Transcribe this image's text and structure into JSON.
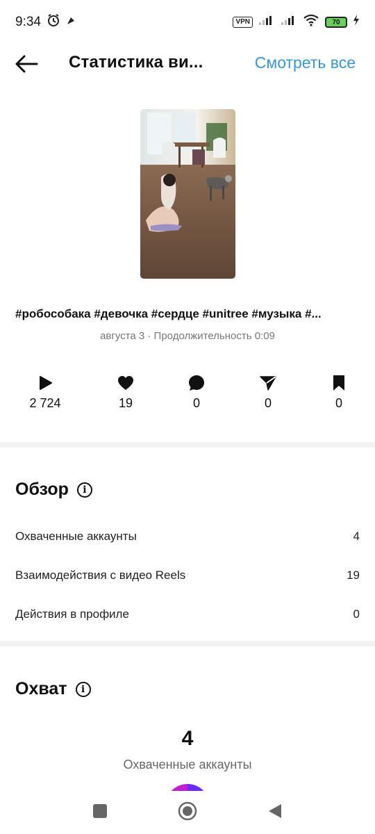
{
  "status_bar": {
    "time": "9:34",
    "vpn": "VPN",
    "battery": "70",
    "icons": [
      "alarm-icon",
      "notification-icon",
      "signal-icon",
      "wifi-icon",
      "charging-icon"
    ]
  },
  "header": {
    "title": "Статистика ви...",
    "see_all": "Смотреть все"
  },
  "post": {
    "caption": "#робособака #девочка #сердце #unitree #музыка #...",
    "meta": "августа 3 · Продолжительность 0:09"
  },
  "metrics": [
    {
      "icon": "play-icon",
      "value": "2 724"
    },
    {
      "icon": "heart-icon",
      "value": "19"
    },
    {
      "icon": "comment-icon",
      "value": "0"
    },
    {
      "icon": "share-icon",
      "value": "0"
    },
    {
      "icon": "bookmark-icon",
      "value": "0"
    }
  ],
  "overview": {
    "title": "Обзор",
    "rows": [
      {
        "label": "Охваченные аккаунты",
        "value": "4"
      },
      {
        "label": "Взаимодействия с видео Reels",
        "value": "19"
      },
      {
        "label": "Действия в профиле",
        "value": "0"
      }
    ]
  },
  "reach": {
    "title": "Охват",
    "count": "4",
    "label": "Охваченные аккаунты"
  },
  "colors": {
    "accent": "#3897d6",
    "donut_a": "#c21fd0",
    "donut_b": "#6a2cf0"
  }
}
